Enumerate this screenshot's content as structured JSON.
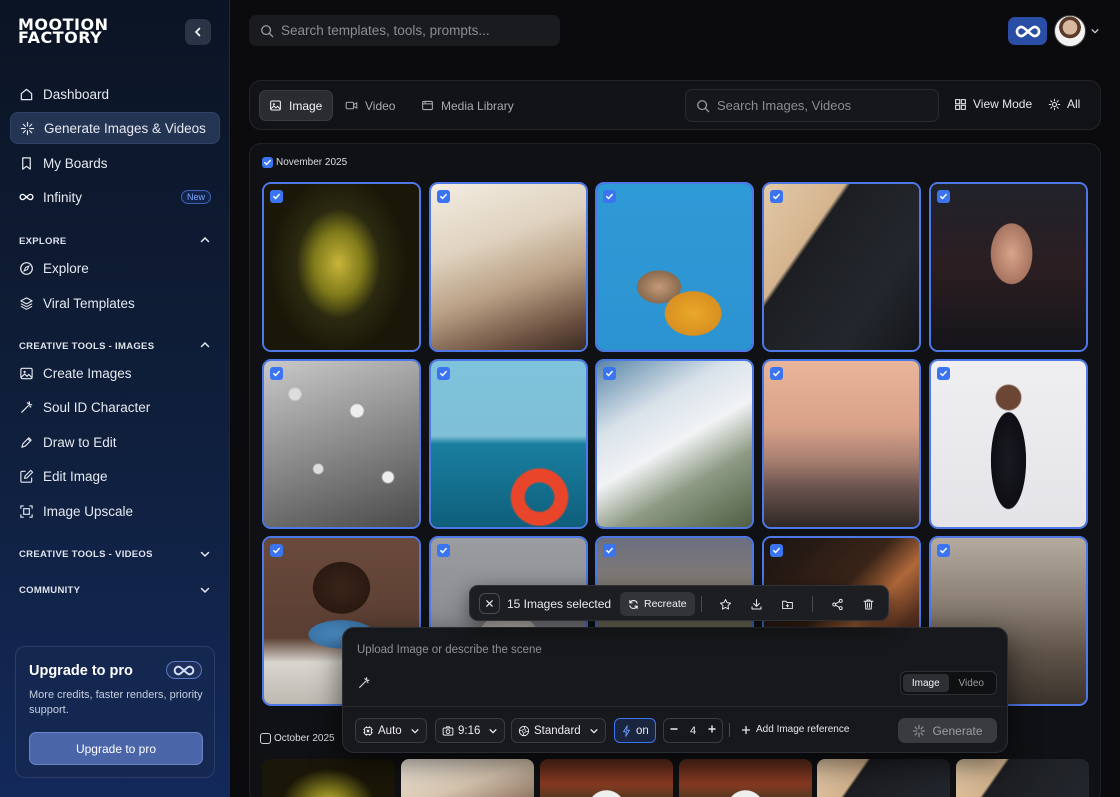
{
  "brand": {
    "line1": "MOOTION",
    "line2": "FACTORY"
  },
  "top_search": {
    "placeholder": "Search templates, tools, prompts..."
  },
  "nav": {
    "dashboard": "Dashboard",
    "generate": "Generate Images & Videos",
    "boards": "My Boards",
    "infinity": "Infinity",
    "infinity_badge": "New"
  },
  "sections": {
    "explore": {
      "label": "EXPLORE",
      "items": [
        "Explore",
        "Viral Templates"
      ]
    },
    "images": {
      "label": "CREATIVE TOOLS - IMAGES",
      "items": [
        "Create Images",
        "Soul ID Character",
        "Draw to Edit",
        "Edit Image",
        "Image Upscale"
      ]
    },
    "videos": {
      "label": "CREATIVE TOOLS - VIDEOS"
    },
    "community": {
      "label": "COMMUNITY"
    }
  },
  "upgrade": {
    "title": "Upgrade to pro",
    "description": "More credits, faster renders, priority support.",
    "button": "Upgrade to pro"
  },
  "toolbar": {
    "tabs": [
      "Image",
      "Video",
      "Media Library"
    ],
    "search_placeholder": "Search Images, Videos",
    "view_mode": "View Mode",
    "filter": "All"
  },
  "groups": [
    {
      "label": "November 2025",
      "checked": true
    },
    {
      "label": "October 2025",
      "checked": false
    }
  ],
  "selection": {
    "count_text": "15 Images selected",
    "recreate": "Recreate"
  },
  "prompt": {
    "placeholder": "Upload Image or describe the scene",
    "modes": [
      "Image",
      "Video"
    ],
    "active_mode": "Image",
    "model": "Auto",
    "aspect": "9:16",
    "quality": "Standard",
    "boost": "on",
    "quantity": "4",
    "add_reference": "Add Image reference",
    "generate": "Generate"
  },
  "colors": {
    "accent": "#3b74f0",
    "selection_border": "#4d78e6"
  }
}
